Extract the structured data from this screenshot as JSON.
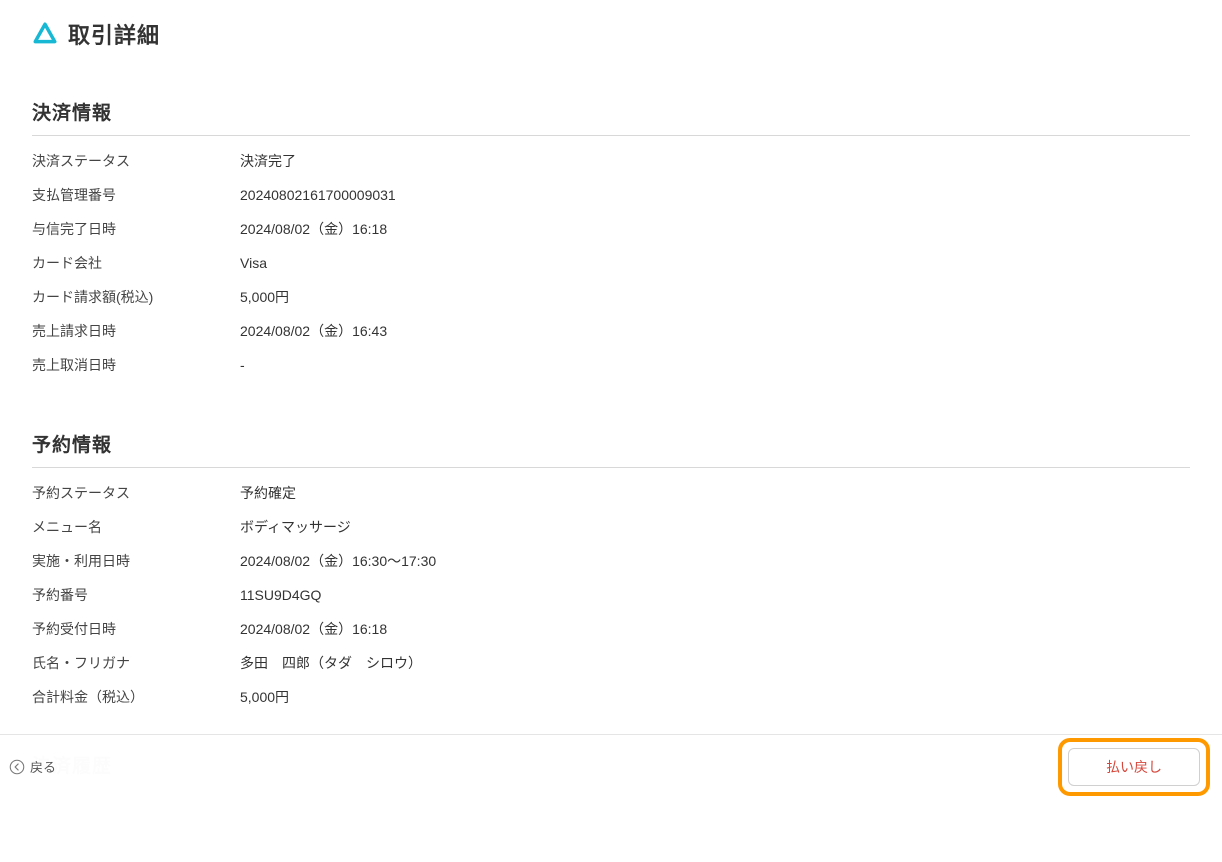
{
  "header": {
    "title": "取引詳細"
  },
  "payment": {
    "section_title": "決済情報",
    "rows": [
      {
        "label": "決済ステータス",
        "value": "決済完了"
      },
      {
        "label": "支払管理番号",
        "value": "20240802161700009031"
      },
      {
        "label": "与信完了日時",
        "value": "2024/08/02（金）16:18"
      },
      {
        "label": "カード会社",
        "value": "Visa"
      },
      {
        "label": "カード請求額(税込)",
        "value": "5,000円"
      },
      {
        "label": "売上請求日時",
        "value": "2024/08/02（金）16:43"
      },
      {
        "label": "売上取消日時",
        "value": "-"
      }
    ]
  },
  "reservation": {
    "section_title": "予約情報",
    "rows": [
      {
        "label": "予約ステータス",
        "value": "予約確定"
      },
      {
        "label": "メニュー名",
        "value": "ボディマッサージ"
      },
      {
        "label": "実施・利用日時",
        "value": "2024/08/02（金）16:30〜17:30"
      },
      {
        "label": "予約番号",
        "value": "11SU9D4GQ"
      },
      {
        "label": "予約受付日時",
        "value": "2024/08/02（金）16:18"
      },
      {
        "label": "氏名・フリガナ",
        "value": "多田　四郎（タダ　シロウ）"
      },
      {
        "label": "合計料金（税込）",
        "value": "5,000円"
      }
    ]
  },
  "ghost_section_title": "決済履歴",
  "footer": {
    "back_label": "戻る",
    "refund_label": "払い戻し"
  },
  "colors": {
    "accent": "#00b4d8",
    "highlight": "#ff9900",
    "danger": "#d6473b"
  }
}
